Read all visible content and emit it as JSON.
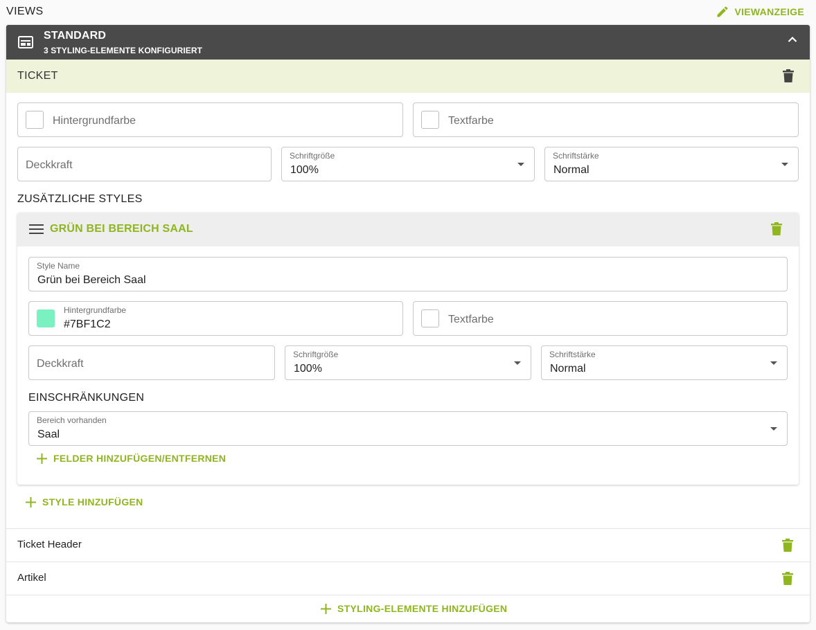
{
  "header": {
    "title": "VIEWS",
    "action_label": "VIEWANZEIGE"
  },
  "view": {
    "title": "STANDARD",
    "subtitle": "3 STYLING-ELEMENTE KONFIGURIERT"
  },
  "ticket": {
    "title": "TICKET",
    "hintergrundfarbe_placeholder": "Hintergrundfarbe",
    "textfarbe_placeholder": "Textfarbe",
    "deckkraft_placeholder": "Deckkraft",
    "schriftgroesse_label": "Schriftgröße",
    "schriftgroesse_value": "100%",
    "schriftstaerke_label": "Schriftstärke",
    "schriftstaerke_value": "Normal"
  },
  "additional_styles": {
    "section_title": "ZUSÄTZLICHE STYLES",
    "style": {
      "title": "GRÜN BEI BEREICH SAAL",
      "name_label": "Style Name",
      "name_value": "Grün bei Bereich Saal",
      "hintergrundfarbe_label": "Hintergrundfarbe",
      "hintergrundfarbe_value": "#7BF1C2",
      "swatch_color": "#7BF1C2",
      "textfarbe_placeholder": "Textfarbe",
      "deckkraft_placeholder": "Deckkraft",
      "schriftgroesse_label": "Schriftgröße",
      "schriftgroesse_value": "100%",
      "schriftstaerke_label": "Schriftstärke",
      "schriftstaerke_value": "Normal",
      "restrictions_title": "EINSCHRÄNKUNGEN",
      "bereich_label": "Bereich vorhanden",
      "bereich_value": "Saal",
      "add_fields_label": "FELDER HINZUFÜGEN/ENTFERNEN"
    },
    "add_style_label": "STYLE HINZUFÜGEN"
  },
  "elements": [
    {
      "label": "Ticket Header"
    },
    {
      "label": "Artikel"
    }
  ],
  "add_elements_label": "STYLING-ELEMENTE HINZUFÜGEN",
  "colors": {
    "accent": "#8fb51f",
    "header_bg": "#4a4a4a",
    "ticket_bar_bg": "#eef3d9"
  }
}
